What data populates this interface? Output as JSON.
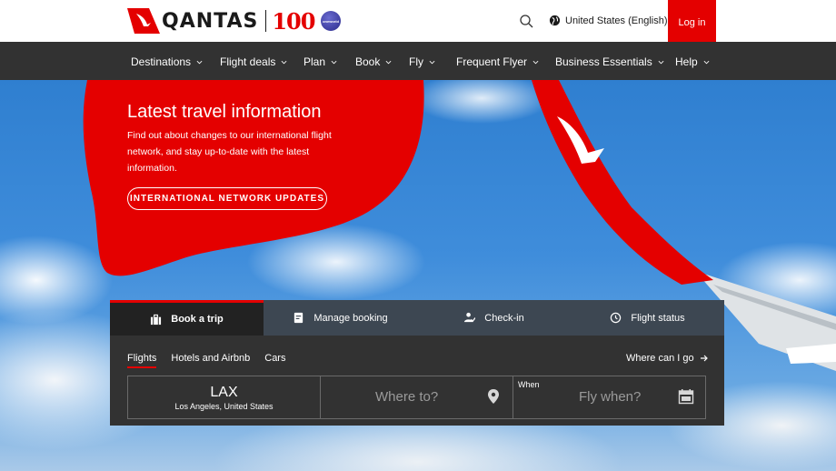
{
  "header": {
    "brand": "QANTAS",
    "hundred": "100",
    "oneworld_label": "oneworld",
    "language": "United States (English)",
    "login_label": "Log in"
  },
  "nav": {
    "items": [
      {
        "label": "Destinations"
      },
      {
        "label": "Flight deals"
      },
      {
        "label": "Plan"
      },
      {
        "label": "Book"
      },
      {
        "label": "Fly"
      },
      {
        "label": "Frequent Flyer"
      },
      {
        "label": "Business Essentials"
      },
      {
        "label": "Help"
      }
    ]
  },
  "hero": {
    "title": "Latest travel information",
    "description": "Find out about changes to our international flight network, and stay up-to-date with the latest information.",
    "cta_label": "INTERNATIONAL NETWORK UPDATES"
  },
  "booking": {
    "tabs": [
      {
        "label": "Book a trip",
        "icon": "suitcase-icon"
      },
      {
        "label": "Manage booking",
        "icon": "boarding-pass-icon"
      },
      {
        "label": "Check-in",
        "icon": "person-check-icon"
      },
      {
        "label": "Flight status",
        "icon": "clock-icon"
      }
    ],
    "subtabs": [
      {
        "label": "Flights"
      },
      {
        "label": "Hotels and Airbnb"
      },
      {
        "label": "Cars"
      }
    ],
    "where_can_i_go": "Where can I go",
    "from_code": "LAX",
    "from_city": "Los Angeles, United States",
    "to_placeholder": "Where to?",
    "when_label": "When",
    "when_placeholder": "Fly when?"
  },
  "colors": {
    "brand_red": "#e40000",
    "nav_bg": "#323232",
    "panel_bg": "#323232"
  }
}
